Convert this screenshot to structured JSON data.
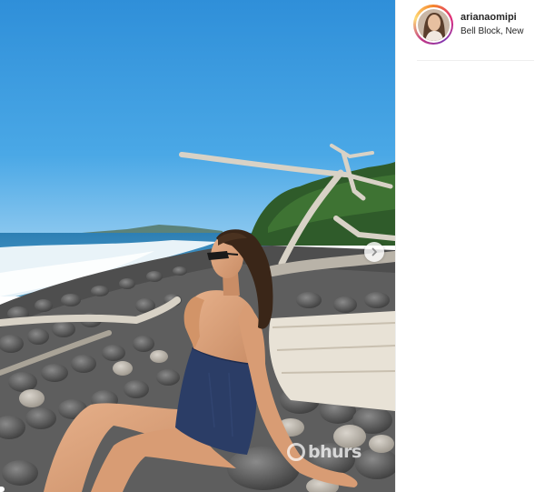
{
  "post": {
    "username": "arianaomipi",
    "location": "Bell Block, New"
  },
  "photo": {
    "subject": "woman in a navy strapless swimsuit and sunglasses sitting on a pebble beach with driftwood",
    "watermark": "bhurs"
  },
  "icons": {
    "next": "chevron-right-icon"
  },
  "colors": {
    "sky": "#3d9be0",
    "sea": "#3a8fc0",
    "swimsuit": "#2b3d66",
    "text": "#262626",
    "divider": "#efefef"
  }
}
